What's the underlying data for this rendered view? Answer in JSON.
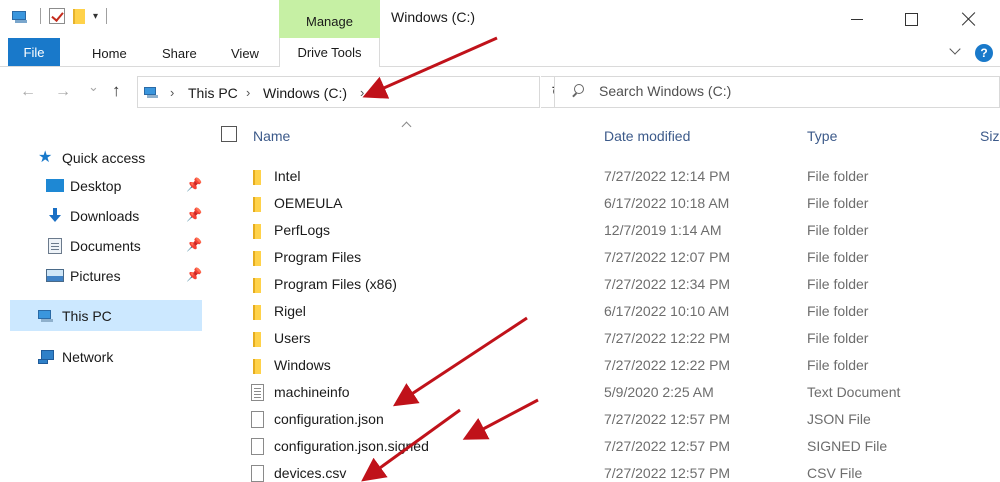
{
  "window": {
    "title": "Windows (C:)",
    "contextual_tab_group": "Manage"
  },
  "ribbon": {
    "tabs": [
      "File",
      "Home",
      "Share",
      "View",
      "Drive Tools"
    ],
    "help": "?"
  },
  "nav": {
    "back_glyph": "←",
    "forward_glyph": "→",
    "recent_glyph": "⌄",
    "up_glyph": "↑",
    "refresh_glyph": "↻",
    "crumb_sep": "›",
    "breadcrumb": [
      "This PC",
      "Windows (C:)"
    ],
    "search_placeholder": "Search Windows (C:)"
  },
  "sidebar": {
    "quick_access": "Quick access",
    "pin_glyph": "📌",
    "pinned": [
      {
        "label": "Desktop",
        "icon": "desktop-icon"
      },
      {
        "label": "Downloads",
        "icon": "downloads-icon"
      },
      {
        "label": "Documents",
        "icon": "documents-icon"
      },
      {
        "label": "Pictures",
        "icon": "pictures-icon"
      }
    ],
    "this_pc": "This PC",
    "network": "Network"
  },
  "columns": [
    "Name",
    "Date modified",
    "Type",
    "Size"
  ],
  "files": [
    {
      "name": "Intel",
      "date": "7/27/2022 12:14 PM",
      "type": "File folder",
      "icon": "folder-icon"
    },
    {
      "name": "OEMEULA",
      "date": "6/17/2022 10:18 AM",
      "type": "File folder",
      "icon": "folder-icon"
    },
    {
      "name": "PerfLogs",
      "date": "12/7/2019 1:14 AM",
      "type": "File folder",
      "icon": "folder-icon"
    },
    {
      "name": "Program Files",
      "date": "7/27/2022 12:07 PM",
      "type": "File folder",
      "icon": "folder-icon"
    },
    {
      "name": "Program Files (x86)",
      "date": "7/27/2022 12:34 PM",
      "type": "File folder",
      "icon": "folder-icon"
    },
    {
      "name": "Rigel",
      "date": "6/17/2022 10:10 AM",
      "type": "File folder",
      "icon": "folder-icon"
    },
    {
      "name": "Users",
      "date": "7/27/2022 12:22 PM",
      "type": "File folder",
      "icon": "folder-icon"
    },
    {
      "name": "Windows",
      "date": "7/27/2022 12:22 PM",
      "type": "File folder",
      "icon": "folder-icon"
    },
    {
      "name": "machineinfo",
      "date": "5/9/2020 2:25 AM",
      "type": "Text Document",
      "icon": "text-file-icon"
    },
    {
      "name": "configuration.json",
      "date": "7/27/2022 12:57 PM",
      "type": "JSON File",
      "icon": "file-icon"
    },
    {
      "name": "configuration.json.signed",
      "date": "7/27/2022 12:57 PM",
      "type": "SIGNED File",
      "icon": "file-icon"
    },
    {
      "name": "devices.csv",
      "date": "7/27/2022 12:57 PM",
      "type": "CSV File",
      "icon": "file-icon"
    }
  ],
  "colors": {
    "accent": "#1979ca",
    "manage_tab": "#c6f0a4",
    "selection": "#cce8ff",
    "annotation_arrow": "#c0121a"
  }
}
